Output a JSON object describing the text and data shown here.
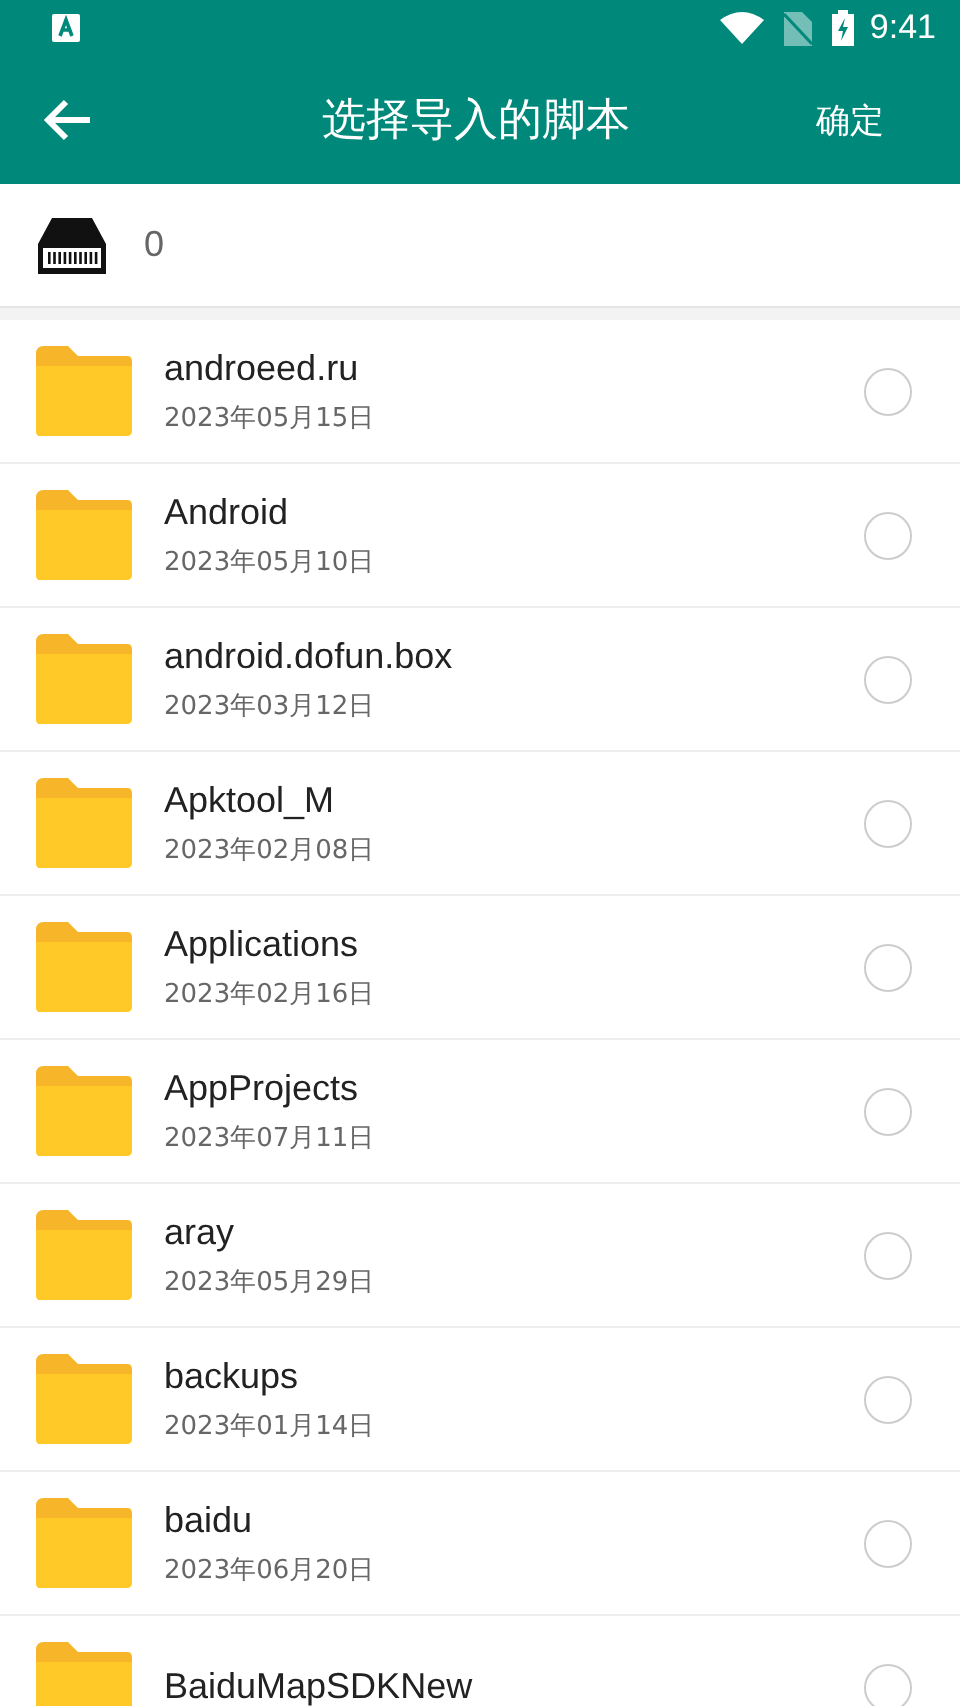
{
  "status_bar": {
    "time": "9:41"
  },
  "app_bar": {
    "title": "选择导入的脚本",
    "action": "确定"
  },
  "storage": {
    "count": "0"
  },
  "folders": [
    {
      "name": "androeed.ru",
      "date": "2023年05月15日",
      "selected": false
    },
    {
      "name": "Android",
      "date": "2023年05月10日",
      "selected": false
    },
    {
      "name": "android.dofun.box",
      "date": "2023年03月12日",
      "selected": false
    },
    {
      "name": "Apktool_M",
      "date": "2023年02月08日",
      "selected": false
    },
    {
      "name": "Applications",
      "date": "2023年02月16日",
      "selected": false
    },
    {
      "name": "AppProjects",
      "date": "2023年07月11日",
      "selected": false
    },
    {
      "name": "aray",
      "date": "2023年05月29日",
      "selected": false
    },
    {
      "name": "backups",
      "date": "2023年01月14日",
      "selected": false
    },
    {
      "name": "baidu",
      "date": "2023年06月20日",
      "selected": false
    },
    {
      "name": "BaiduMapSDKNew",
      "selected": false
    }
  ]
}
